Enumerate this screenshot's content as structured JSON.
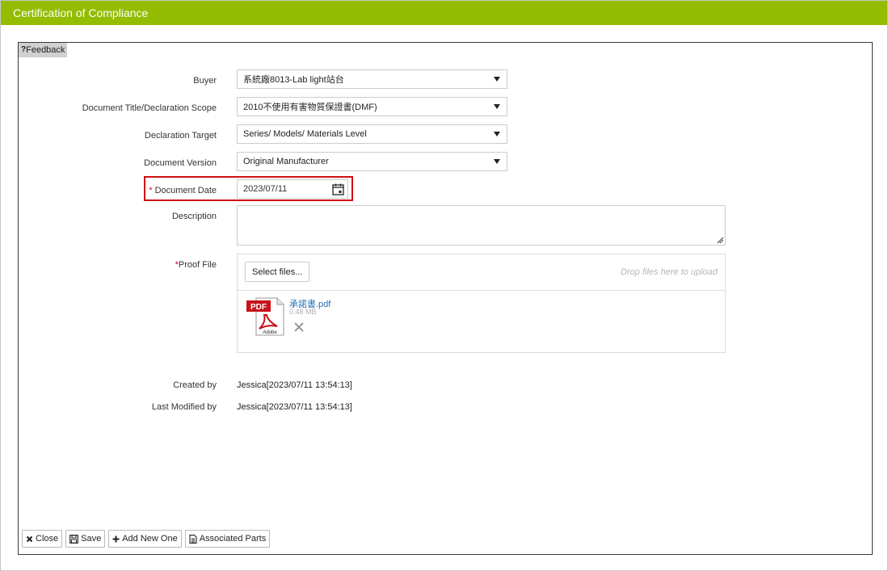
{
  "window": {
    "title": "Certification of Compliance"
  },
  "feedback": {
    "label": "Feedback"
  },
  "form": {
    "buyer": {
      "label": "Buyer",
      "value": "系統廠8013-Lab light站台"
    },
    "doc_title": {
      "label": "Document Title/Declaration Scope",
      "value": "2010不使用有害物質保證書(DMF)"
    },
    "target": {
      "label": "Declaration Target",
      "value": "Series/ Models/ Materials Level"
    },
    "version": {
      "label": "Document Version",
      "value": "Original Manufacturer"
    },
    "date": {
      "required_mark": "*",
      "label": "Document Date",
      "value": "2023/07/11"
    },
    "description": {
      "label": "Description",
      "value": ""
    },
    "proof": {
      "required_mark": "*",
      "label": "Proof File",
      "select_label": "Select files...",
      "drop_hint": "Drop files here to upload",
      "file": {
        "name": "承諾書.pdf",
        "size": "0.48 MB",
        "icon_text": "PDF",
        "icon_brand": "Adobe"
      }
    }
  },
  "meta": {
    "created_label": "Created by",
    "created_value": "Jessica[2023/07/11 13:54:13]",
    "modified_label": "Last Modified by",
    "modified_value": "Jessica[2023/07/11 13:54:13]"
  },
  "buttons": {
    "close": "Close",
    "save": "Save",
    "add_new": "Add New One",
    "associated": "Associated Parts"
  },
  "colors": {
    "titlebar": "#94bc00",
    "required": "#d0021b",
    "highlight_outline": "#d01010",
    "link": "#1f6fb5"
  }
}
